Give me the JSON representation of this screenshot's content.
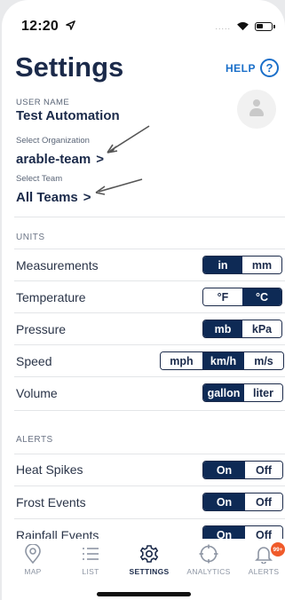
{
  "status_bar": {
    "time": "12:20",
    "signal": "....."
  },
  "header": {
    "title": "Settings",
    "help_label": "HELP",
    "help_icon": "?"
  },
  "profile": {
    "user_name_label": "USER NAME",
    "user_name": "Test Automation",
    "org_label": "Select Organization",
    "org_value": "arable-team",
    "team_label": "Select Team",
    "team_value": "All Teams",
    "chevron": ">"
  },
  "units": {
    "header": "UNITS",
    "rows": [
      {
        "label": "Measurements",
        "options": [
          "in",
          "mm"
        ],
        "selected": "in"
      },
      {
        "label": "Temperature",
        "options": [
          "°F",
          "°C"
        ],
        "selected": "°C"
      },
      {
        "label": "Pressure",
        "options": [
          "mb",
          "kPa"
        ],
        "selected": "mb"
      },
      {
        "label": "Speed",
        "options": [
          "mph",
          "km/h",
          "m/s"
        ],
        "selected": "km/h"
      },
      {
        "label": "Volume",
        "options": [
          "gallon",
          "liter"
        ],
        "selected": "gallon"
      }
    ]
  },
  "alerts": {
    "header": "ALERTS",
    "rows": [
      {
        "label": "Heat Spikes",
        "options": [
          "On",
          "Off"
        ],
        "selected": "On"
      },
      {
        "label": "Frost Events",
        "options": [
          "On",
          "Off"
        ],
        "selected": "On"
      },
      {
        "label": "Rainfall Events",
        "options": [
          "On",
          "Off"
        ],
        "selected": "On"
      }
    ]
  },
  "tabbar": {
    "tabs": [
      {
        "label": "MAP",
        "icon": "map-pin-icon"
      },
      {
        "label": "LIST",
        "icon": "list-icon"
      },
      {
        "label": "SETTINGS",
        "icon": "gear-icon",
        "active": true
      },
      {
        "label": "ANALYTICS",
        "icon": "crosshair-icon"
      },
      {
        "label": "ALERTS",
        "icon": "bell-icon",
        "badge": "99+"
      }
    ]
  },
  "colors": {
    "navy": "#0e2a55",
    "accent_blue": "#1a6fc9",
    "badge_orange": "#f05a2a",
    "arrow_gray": "#555555"
  }
}
